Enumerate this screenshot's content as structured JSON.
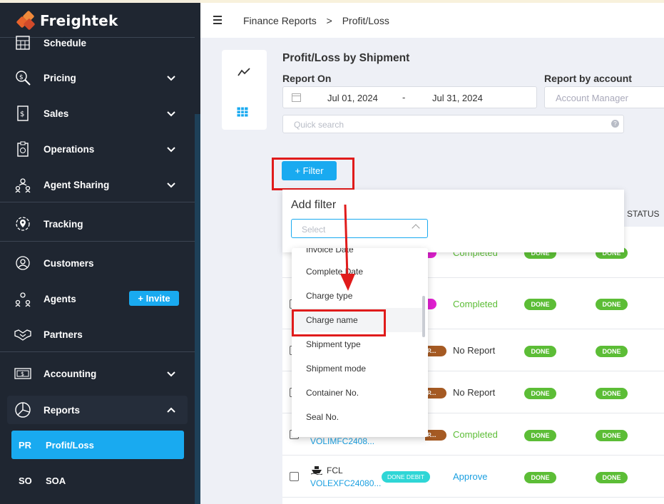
{
  "app": {
    "name": "Freightek"
  },
  "sidebar": {
    "items": [
      {
        "label": "Schedule"
      },
      {
        "label": "Pricing"
      },
      {
        "label": "Sales"
      },
      {
        "label": "Operations"
      },
      {
        "label": "Agent Sharing"
      },
      {
        "label": "Tracking"
      },
      {
        "label": "Customers"
      },
      {
        "label": "Agents"
      },
      {
        "label": "Partners"
      },
      {
        "label": "Accounting"
      },
      {
        "label": "Reports"
      }
    ],
    "invite_label": "+ Invite",
    "sub_items": [
      {
        "abbr": "PR",
        "label": "Profit/Loss",
        "active": true
      },
      {
        "abbr": "SO",
        "label": "SOA",
        "active": false
      }
    ]
  },
  "breadcrumb": {
    "section": "Finance Reports",
    "separator": ">",
    "page": "Profit/Loss"
  },
  "report": {
    "title": "Profit/Loss by Shipment",
    "report_on_label": "Report On",
    "date_from": "Jul 01, 2024",
    "date_sep": "-",
    "date_to": "Jul 31, 2024",
    "report_by_account_label": "Report by account",
    "account_placeholder": "Account Manager",
    "search_placeholder": "Quick search"
  },
  "filter": {
    "button_label": "+ Filter",
    "popup_title": "Add filter",
    "select_placeholder": "Select",
    "options": [
      "Invoice Date",
      "Complete Date",
      "Charge type",
      "Charge name",
      "Shipment type",
      "Shipment mode",
      "Container No.",
      "Seal No."
    ],
    "highlighted": "Charge name"
  },
  "table": {
    "status_header": "STATUS",
    "rows": [
      {
        "status": "Completed",
        "badge1": "DONE",
        "badge2": "DONE"
      },
      {
        "status": "Completed",
        "badge1": "DONE",
        "badge2": "DONE"
      },
      {
        "status": "No Report",
        "badge1": "DONE",
        "badge2": "DONE",
        "tag": "R..."
      },
      {
        "status": "No Report",
        "badge1": "DONE",
        "badge2": "DONE",
        "tag": "R..."
      },
      {
        "status": "Completed",
        "badge1": "DONE",
        "badge2": "DONE",
        "tag": "R...",
        "shipment_no": "VOLIMFC2408..."
      },
      {
        "status": "Approve",
        "badge1": "DONE",
        "badge2": "DONE",
        "mode": "FCL",
        "shipment_no": "VOLEXFC24080...",
        "debit": "DONE DEBIT"
      }
    ]
  },
  "colors": {
    "accent": "#19aaf0",
    "sidebar": "#1f2631",
    "success": "#5cbd36",
    "highlight": "#e01b1b"
  }
}
